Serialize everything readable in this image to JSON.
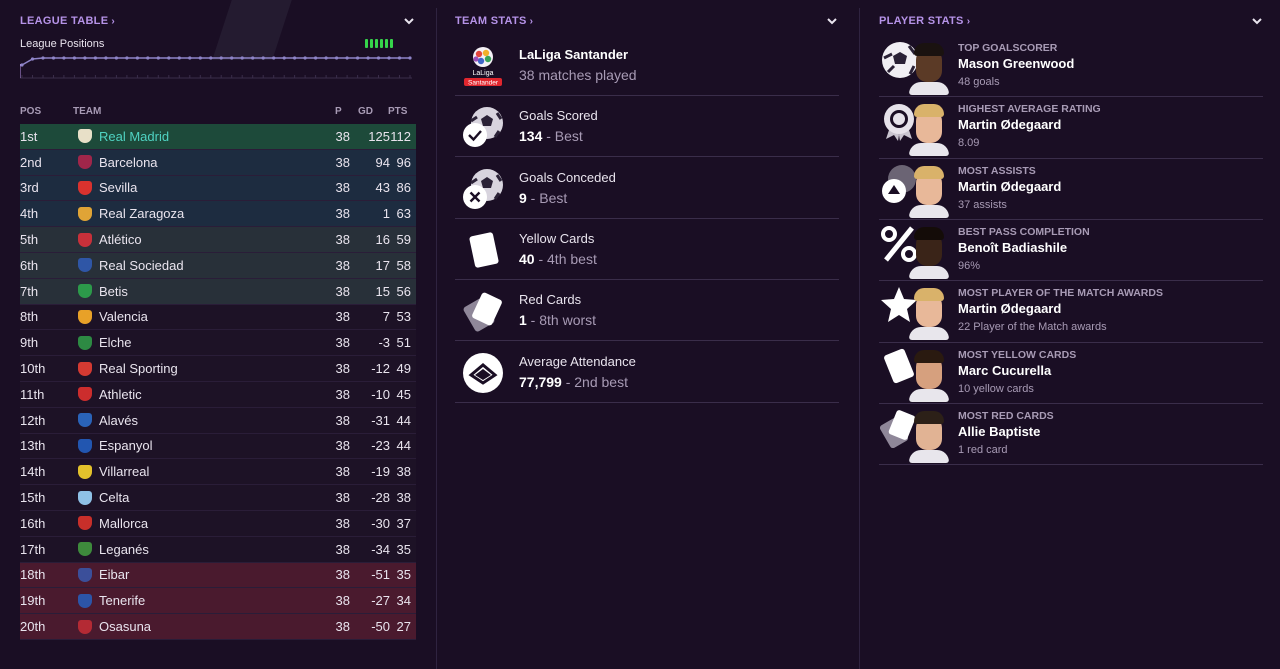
{
  "league_table": {
    "header": "LEAGUE TABLE",
    "positions_label": "League Positions",
    "columns": {
      "pos": "POS",
      "team": "TEAM",
      "p": "P",
      "gd": "GD",
      "pts": "PTS"
    },
    "rows": [
      {
        "pos": "1st",
        "team": "Real Madrid",
        "p": "38",
        "gd": "125",
        "pts": "112",
        "zone": "z-first",
        "badge": "#e8e0c8"
      },
      {
        "pos": "2nd",
        "team": "Barcelona",
        "p": "38",
        "gd": "94",
        "pts": "96",
        "zone": "z-cl",
        "badge": "#a0264a"
      },
      {
        "pos": "3rd",
        "team": "Sevilla",
        "p": "38",
        "gd": "43",
        "pts": "86",
        "zone": "z-cl",
        "badge": "#d9322e"
      },
      {
        "pos": "4th",
        "team": "Real Zaragoza",
        "p": "38",
        "gd": "1",
        "pts": "63",
        "zone": "z-cl",
        "badge": "#e0a436"
      },
      {
        "pos": "5th",
        "team": "Atlético",
        "p": "38",
        "gd": "16",
        "pts": "59",
        "zone": "z-el",
        "badge": "#c8303a"
      },
      {
        "pos": "6th",
        "team": "Real Sociedad",
        "p": "38",
        "gd": "17",
        "pts": "58",
        "zone": "z-el",
        "badge": "#2f56a6"
      },
      {
        "pos": "7th",
        "team": "Betis",
        "p": "38",
        "gd": "15",
        "pts": "56",
        "zone": "z-el",
        "badge": "#2c9a4a"
      },
      {
        "pos": "8th",
        "team": "Valencia",
        "p": "38",
        "gd": "7",
        "pts": "53",
        "zone": "z-none",
        "badge": "#e8a128"
      },
      {
        "pos": "9th",
        "team": "Elche",
        "p": "38",
        "gd": "-3",
        "pts": "51",
        "zone": "z-none",
        "badge": "#2d8a43"
      },
      {
        "pos": "10th",
        "team": "Real Sporting",
        "p": "38",
        "gd": "-12",
        "pts": "49",
        "zone": "z-none",
        "badge": "#d43a32"
      },
      {
        "pos": "11th",
        "team": "Athletic",
        "p": "38",
        "gd": "-10",
        "pts": "45",
        "zone": "z-none",
        "badge": "#cc2d2d"
      },
      {
        "pos": "12th",
        "team": "Alavés",
        "p": "38",
        "gd": "-31",
        "pts": "44",
        "zone": "z-none",
        "badge": "#2a63b8"
      },
      {
        "pos": "13th",
        "team": "Espanyol",
        "p": "38",
        "gd": "-23",
        "pts": "44",
        "zone": "z-none",
        "badge": "#2256b0"
      },
      {
        "pos": "14th",
        "team": "Villarreal",
        "p": "38",
        "gd": "-19",
        "pts": "38",
        "zone": "z-none",
        "badge": "#e3c22c"
      },
      {
        "pos": "15th",
        "team": "Celta",
        "p": "38",
        "gd": "-28",
        "pts": "38",
        "zone": "z-none",
        "badge": "#8fc1e6"
      },
      {
        "pos": "16th",
        "team": "Mallorca",
        "p": "38",
        "gd": "-30",
        "pts": "37",
        "zone": "z-none",
        "badge": "#c82f2a"
      },
      {
        "pos": "17th",
        "team": "Leganés",
        "p": "38",
        "gd": "-34",
        "pts": "35",
        "zone": "z-none",
        "badge": "#3e8a3c"
      },
      {
        "pos": "18th",
        "team": "Eibar",
        "p": "38",
        "gd": "-51",
        "pts": "35",
        "zone": "z-rel",
        "badge": "#3b4f9a"
      },
      {
        "pos": "19th",
        "team": "Tenerife",
        "p": "38",
        "gd": "-27",
        "pts": "34",
        "zone": "z-rel",
        "badge": "#2c55a8"
      },
      {
        "pos": "20th",
        "team": "Osasuna",
        "p": "38",
        "gd": "-50",
        "pts": "27",
        "zone": "z-rel",
        "badge": "#b42a34"
      }
    ]
  },
  "team_stats": {
    "header": "TEAM STATS",
    "items": [
      {
        "icon": "laliga-logo",
        "label": "LaLiga Santander",
        "value_bold": "",
        "value_rest": "38 matches played",
        "label_bold": true
      },
      {
        "icon": "goals-scored-ball-icon",
        "label": "Goals Scored",
        "value_bold": "134",
        "value_rest": " - Best"
      },
      {
        "icon": "goals-conceded-ball-icon",
        "label": "Goals Conceded",
        "value_bold": "9",
        "value_rest": " - Best"
      },
      {
        "icon": "yellow-card-icon",
        "label": "Yellow Cards",
        "value_bold": "40",
        "value_rest": " - 4th best"
      },
      {
        "icon": "red-card-icon",
        "label": "Red Cards",
        "value_bold": "1",
        "value_rest": " - 8th worst"
      },
      {
        "icon": "stadium-icon",
        "label": "Average Attendance",
        "value_bold": "77,799",
        "value_rest": " - 2nd best"
      }
    ]
  },
  "player_stats": {
    "header": "PLAYER STATS",
    "items": [
      {
        "icon": "ball-icon",
        "category": "TOP GOALSCORER",
        "name": "Mason Greenwood",
        "value": "48 goals",
        "skin": "#5b3a26",
        "hair": "#1a1210"
      },
      {
        "icon": "rosette-icon",
        "category": "HIGHEST AVERAGE RATING",
        "name": "Martin Ødegaard",
        "value": "8.09",
        "skin": "#e8b899",
        "hair": "#d9b26a"
      },
      {
        "icon": "assist-icon",
        "category": "MOST ASSISTS",
        "name": "Martin Ødegaard",
        "value": "37 assists",
        "skin": "#e8b899",
        "hair": "#d9b26a"
      },
      {
        "icon": "percent-icon",
        "category": "BEST PASS COMPLETION",
        "name": "Benoît Badiashile",
        "value": "96%",
        "skin": "#3a2418",
        "hair": "#140c08"
      },
      {
        "icon": "star-icon",
        "category": "MOST PLAYER OF THE MATCH AWARDS",
        "name": "Martin Ødegaard",
        "value": "22 Player of the Match awards",
        "skin": "#e8b899",
        "hair": "#d9b26a"
      },
      {
        "icon": "yellow-card-icon",
        "category": "MOST YELLOW CARDS",
        "name": "Marc Cucurella",
        "value": "10 yellow cards",
        "skin": "#d6a07e",
        "hair": "#2a1a10"
      },
      {
        "icon": "red-card-icon",
        "category": "MOST RED CARDS",
        "name": "Allie Baptiste",
        "value": "1 red card",
        "skin": "#e1b394",
        "hair": "#2c2018"
      }
    ]
  },
  "colors": {
    "accent": "#b693e8",
    "background": "#1a0e24",
    "form_win": "#36d54b",
    "leader": "#4fd3c2"
  }
}
